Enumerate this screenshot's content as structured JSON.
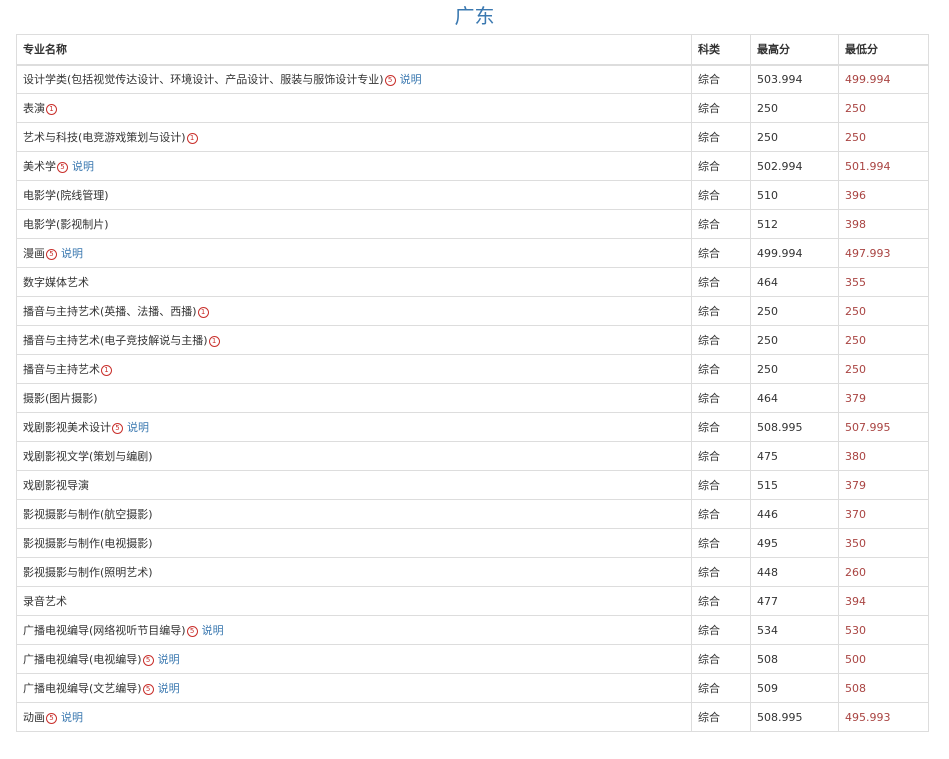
{
  "page": {
    "title": "广东"
  },
  "table": {
    "headers": {
      "name": "专业名称",
      "type": "科类",
      "max": "最高分",
      "min": "最低分"
    },
    "rows": [
      {
        "name": "设计学类(包括视觉传达设计、环境设计、产品设计、服装与服饰设计专业)",
        "mark": "5",
        "link": "说明",
        "type": "综合",
        "max": "503.994",
        "min": "499.994"
      },
      {
        "name": "表演",
        "mark": "1",
        "link": "",
        "type": "综合",
        "max": "250",
        "min": "250"
      },
      {
        "name": "艺术与科技(电竞游戏策划与设计)",
        "mark": "1",
        "link": "",
        "type": "综合",
        "max": "250",
        "min": "250"
      },
      {
        "name": "美术学",
        "mark": "5",
        "link": "说明",
        "type": "综合",
        "max": "502.994",
        "min": "501.994"
      },
      {
        "name": "电影学(院线管理)",
        "mark": "",
        "link": "",
        "type": "综合",
        "max": "510",
        "min": "396"
      },
      {
        "name": "电影学(影视制片)",
        "mark": "",
        "link": "",
        "type": "综合",
        "max": "512",
        "min": "398"
      },
      {
        "name": "漫画",
        "mark": "5",
        "link": "说明",
        "type": "综合",
        "max": "499.994",
        "min": "497.993"
      },
      {
        "name": "数字媒体艺术",
        "mark": "",
        "link": "",
        "type": "综合",
        "max": "464",
        "min": "355"
      },
      {
        "name": "播音与主持艺术(英播、法播、西播)",
        "mark": "1",
        "link": "",
        "type": "综合",
        "max": "250",
        "min": "250"
      },
      {
        "name": "播音与主持艺术(电子竞技解说与主播)",
        "mark": "1",
        "link": "",
        "type": "综合",
        "max": "250",
        "min": "250"
      },
      {
        "name": "播音与主持艺术",
        "mark": "1",
        "link": "",
        "type": "综合",
        "max": "250",
        "min": "250"
      },
      {
        "name": "摄影(图片摄影)",
        "mark": "",
        "link": "",
        "type": "综合",
        "max": "464",
        "min": "379"
      },
      {
        "name": "戏剧影视美术设计",
        "mark": "5",
        "link": "说明",
        "type": "综合",
        "max": "508.995",
        "min": "507.995"
      },
      {
        "name": "戏剧影视文学(策划与编剧)",
        "mark": "",
        "link": "",
        "type": "综合",
        "max": "475",
        "min": "380"
      },
      {
        "name": "戏剧影视导演",
        "mark": "",
        "link": "",
        "type": "综合",
        "max": "515",
        "min": "379"
      },
      {
        "name": "影视摄影与制作(航空摄影)",
        "mark": "",
        "link": "",
        "type": "综合",
        "max": "446",
        "min": "370"
      },
      {
        "name": "影视摄影与制作(电视摄影)",
        "mark": "",
        "link": "",
        "type": "综合",
        "max": "495",
        "min": "350"
      },
      {
        "name": "影视摄影与制作(照明艺术)",
        "mark": "",
        "link": "",
        "type": "综合",
        "max": "448",
        "min": "260"
      },
      {
        "name": "录音艺术",
        "mark": "",
        "link": "",
        "type": "综合",
        "max": "477",
        "min": "394"
      },
      {
        "name": "广播电视编导(网络视听节目编导)",
        "mark": "5",
        "link": "说明",
        "type": "综合",
        "max": "534",
        "min": "530"
      },
      {
        "name": "广播电视编导(电视编导)",
        "mark": "5",
        "link": "说明",
        "type": "综合",
        "max": "508",
        "min": "500"
      },
      {
        "name": "广播电视编导(文艺编导)",
        "mark": "5",
        "link": "说明",
        "type": "综合",
        "max": "509",
        "min": "508"
      },
      {
        "name": "动画",
        "mark": "5",
        "link": "说明",
        "type": "综合",
        "max": "508.995",
        "min": "495.993"
      }
    ]
  },
  "colors": {
    "title": "#3a78b0",
    "link": "#3a78b0",
    "min_score": "#a94442",
    "note_mark": "#c9302c",
    "border": "#dddddd"
  }
}
